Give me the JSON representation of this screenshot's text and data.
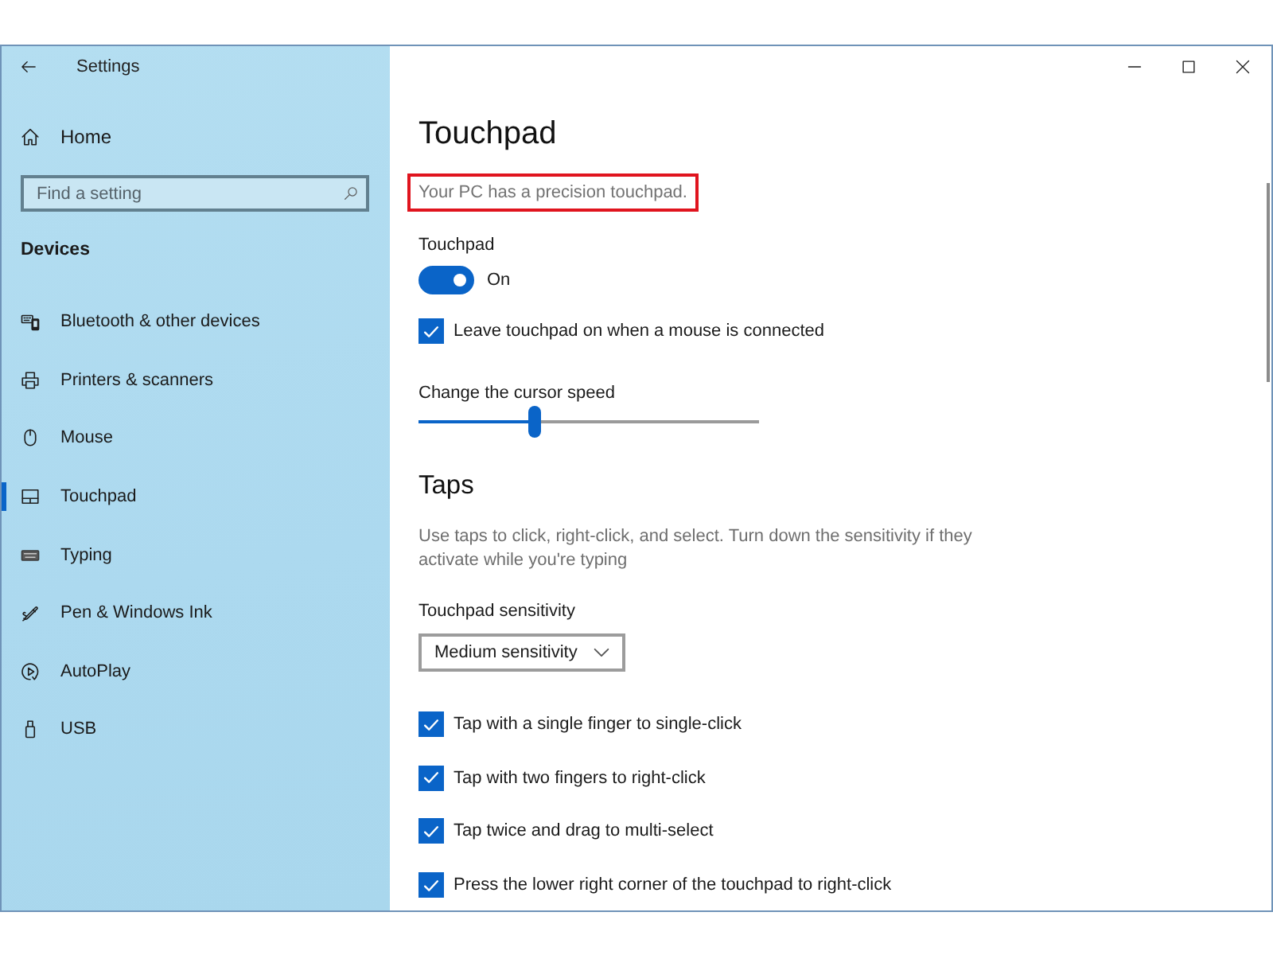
{
  "window": {
    "title": "Settings"
  },
  "sidebar": {
    "home": "Home",
    "search": {
      "placeholder": "Find a setting"
    },
    "section": "Devices",
    "items": [
      {
        "label": "Bluetooth & other devices",
        "selected": false
      },
      {
        "label": "Printers & scanners",
        "selected": false
      },
      {
        "label": "Mouse",
        "selected": false
      },
      {
        "label": "Touchpad",
        "selected": true
      },
      {
        "label": "Typing",
        "selected": false
      },
      {
        "label": "Pen & Windows Ink",
        "selected": false
      },
      {
        "label": "AutoPlay",
        "selected": false
      },
      {
        "label": "USB",
        "selected": false
      }
    ]
  },
  "page": {
    "title": "Touchpad",
    "status": {
      "text": "Your PC has a precision touchpad.",
      "highlighted": true
    },
    "touchpad": {
      "label": "Touchpad",
      "on": true,
      "state": "On"
    },
    "leave_on": {
      "label": "Leave touchpad on when a mouse is connected",
      "checked": true
    },
    "cursor_speed": {
      "label": "Change the cursor speed",
      "level": 0.34
    },
    "taps": {
      "heading": "Taps",
      "description": "Use taps to click, right-click, and select. Turn down the sensitivity if they activate while you're typing",
      "sensitivity": {
        "label": "Touchpad sensitivity",
        "value": "Medium sensitivity"
      },
      "options": [
        {
          "label": "Tap with a single finger to single-click",
          "checked": true
        },
        {
          "label": "Tap with two fingers to right-click",
          "checked": true
        },
        {
          "label": "Tap twice and drag to multi-select",
          "checked": true
        },
        {
          "label": "Press the lower right corner of the touchpad to right-click",
          "checked": true
        }
      ]
    }
  }
}
